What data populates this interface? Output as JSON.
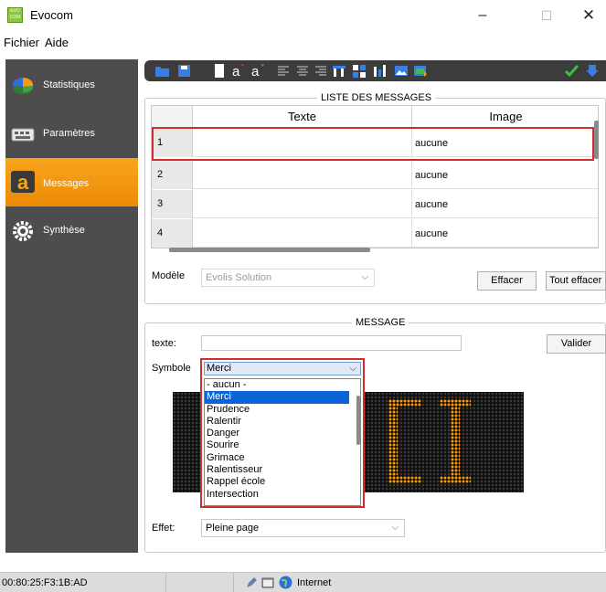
{
  "window": {
    "title": "Evocom",
    "app_icon_text": "EVO COM",
    "minimize": "–",
    "maximize": "☐",
    "close": "✕"
  },
  "menu": {
    "items": [
      "Fichier",
      "Aide"
    ]
  },
  "sidebar": {
    "items": [
      {
        "label": "Statistiques",
        "icon": "pie-chart-icon",
        "active": false
      },
      {
        "label": "Paramètres",
        "icon": "keyboard-icon",
        "active": false
      },
      {
        "label": "Messages",
        "icon": "letter-a-icon",
        "active": true
      },
      {
        "label": "Synthèse",
        "icon": "gear-icon",
        "active": false
      }
    ]
  },
  "toolbar": {
    "icons": [
      "open-folder-icon",
      "save-icon",
      "blank-page-icon",
      "font-size-up-icon",
      "font-size-down-icon",
      "align-left-icon",
      "align-center-icon",
      "align-right-icon",
      "column-layout-icon",
      "grid-layout-icon",
      "bar-layout-icon",
      "image-icon",
      "image-add-icon",
      "check-icon",
      "download-icon"
    ],
    "accent_check": "#3fbf3f",
    "accent_download": "#3a7fe0"
  },
  "messages_list": {
    "title": "LISTE DES MESSAGES",
    "columns": [
      "Texte",
      "Image"
    ],
    "rows": [
      {
        "num": "1",
        "text": "",
        "image": "aucune"
      },
      {
        "num": "2",
        "text": "",
        "image": "aucune"
      },
      {
        "num": "3",
        "text": "",
        "image": "aucune"
      },
      {
        "num": "4",
        "text": "",
        "image": "aucune"
      }
    ],
    "selected_row": "1"
  },
  "model": {
    "label": "Modèle",
    "value": "Evolis Solution"
  },
  "buttons": {
    "clear": "Effacer",
    "clear_all": "Tout effacer",
    "validate": "Valider"
  },
  "message_panel": {
    "title": "MESSAGE",
    "text_label": "texte:",
    "text_value": "",
    "symbol_label": "Symbole",
    "symbol_value": "Merci",
    "symbol_options": [
      "- aucun -",
      "Merci",
      "Prudence",
      "Ralentir",
      "Danger",
      "Sourire",
      "Grimace",
      "Ralentisseur",
      "Rappel école",
      "Intersection"
    ],
    "effect_label": "Effet:",
    "effect_value": "Pleine page",
    "led_text": "CI",
    "led_color": "#ff9a10",
    "highlight_color": "#d62b2b"
  },
  "statusbar": {
    "mac": "00:80:25:F3:1B:AD",
    "connection": "Internet"
  }
}
